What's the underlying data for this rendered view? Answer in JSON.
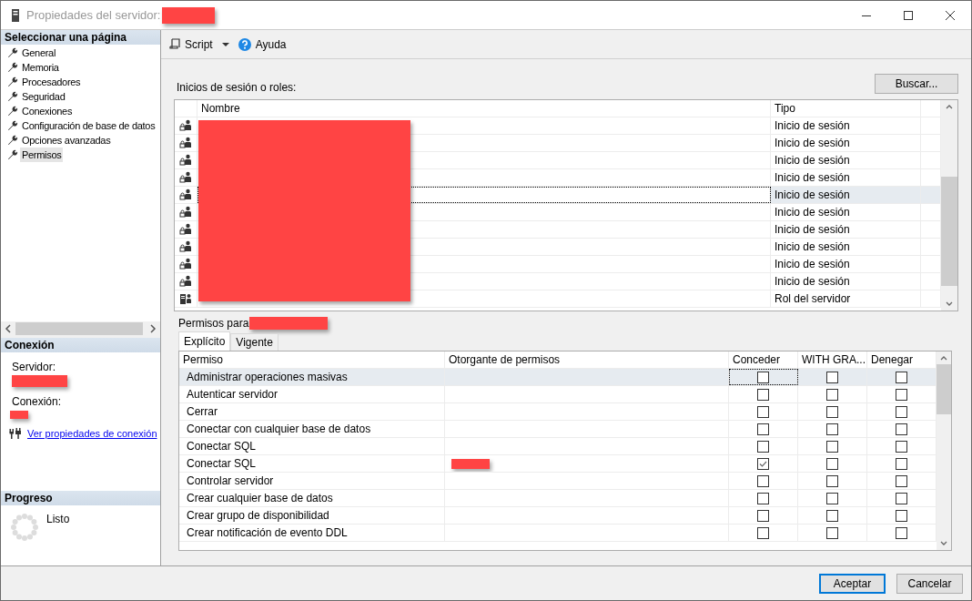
{
  "window": {
    "title": "Propiedades del servidor:",
    "title_redacted": true
  },
  "sidebar": {
    "header": "Seleccionar una página",
    "items": [
      {
        "label": "General",
        "selected": false
      },
      {
        "label": "Memoria",
        "selected": false
      },
      {
        "label": "Procesadores",
        "selected": false
      },
      {
        "label": "Seguridad",
        "selected": false
      },
      {
        "label": "Conexiones",
        "selected": false
      },
      {
        "label": "Configuración de base de datos",
        "selected": false
      },
      {
        "label": "Opciones avanzadas",
        "selected": false
      },
      {
        "label": "Permisos",
        "selected": true
      }
    ]
  },
  "connection": {
    "header": "Conexión",
    "server_label": "Servidor:",
    "server_redacted": true,
    "connection_label": "Conexión:",
    "connection_redacted": true,
    "link": "Ver propiedades de conexión"
  },
  "progress": {
    "header": "Progreso",
    "status": "Listo"
  },
  "toolbar": {
    "script": "Script",
    "help": "Ayuda"
  },
  "logins": {
    "label": "Inicios de sesión o roles:",
    "search_button": "Buscar...",
    "columns": [
      "Nombre",
      "Tipo"
    ],
    "names_redacted": true,
    "rows": [
      {
        "kind": "login",
        "type": "Inicio de sesión",
        "selected": false
      },
      {
        "kind": "login",
        "type": "Inicio de sesión",
        "selected": false
      },
      {
        "kind": "login",
        "type": "Inicio de sesión",
        "selected": false
      },
      {
        "kind": "login",
        "type": "Inicio de sesión",
        "selected": false
      },
      {
        "kind": "login",
        "type": "Inicio de sesión",
        "selected": true
      },
      {
        "kind": "login",
        "type": "Inicio de sesión",
        "selected": false
      },
      {
        "kind": "login",
        "type": "Inicio de sesión",
        "selected": false
      },
      {
        "kind": "login",
        "type": "Inicio de sesión",
        "selected": false
      },
      {
        "kind": "login",
        "type": "Inicio de sesión",
        "selected": false
      },
      {
        "kind": "login",
        "type": "Inicio de sesión",
        "selected": false
      },
      {
        "kind": "role",
        "type": "Rol del servidor",
        "selected": false
      }
    ]
  },
  "permissions": {
    "label": "Permisos para",
    "principal_redacted": true,
    "tabs": [
      {
        "label": "Explícito",
        "selected": true
      },
      {
        "label": "Vigente",
        "selected": false
      }
    ],
    "columns": [
      "Permiso",
      "Otorgante de permisos",
      "Conceder",
      "WITH GRA...",
      "Denegar"
    ],
    "rows": [
      {
        "permission": "Administrar operaciones masivas",
        "grantor_redacted": false,
        "grant": false,
        "with_grant": false,
        "deny": false,
        "selected": true
      },
      {
        "permission": "Autenticar servidor",
        "grantor_redacted": false,
        "grant": false,
        "with_grant": false,
        "deny": false,
        "selected": false
      },
      {
        "permission": "Cerrar",
        "grantor_redacted": false,
        "grant": false,
        "with_grant": false,
        "deny": false,
        "selected": false
      },
      {
        "permission": "Conectar con cualquier base de datos",
        "grantor_redacted": false,
        "grant": false,
        "with_grant": false,
        "deny": false,
        "selected": false
      },
      {
        "permission": "Conectar SQL",
        "grantor_redacted": false,
        "grant": false,
        "with_grant": false,
        "deny": false,
        "selected": false
      },
      {
        "permission": "Conectar SQL",
        "grantor_redacted": true,
        "grant": true,
        "with_grant": false,
        "deny": false,
        "selected": false
      },
      {
        "permission": "Controlar servidor",
        "grantor_redacted": false,
        "grant": false,
        "with_grant": false,
        "deny": false,
        "selected": false
      },
      {
        "permission": "Crear cualquier base de datos",
        "grantor_redacted": false,
        "grant": false,
        "with_grant": false,
        "deny": false,
        "selected": false
      },
      {
        "permission": "Crear grupo de disponibilidad",
        "grantor_redacted": false,
        "grant": false,
        "with_grant": false,
        "deny": false,
        "selected": false
      },
      {
        "permission": "Crear notificación de evento DDL",
        "grantor_redacted": false,
        "grant": false,
        "with_grant": false,
        "deny": false,
        "selected": false
      }
    ]
  },
  "buttons": [
    {
      "label": "Aceptar",
      "default": true
    },
    {
      "label": "Cancelar",
      "default": false
    }
  ]
}
